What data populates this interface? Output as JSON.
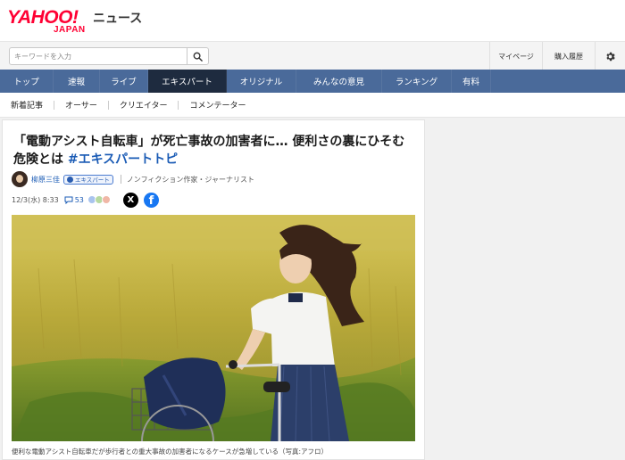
{
  "header": {
    "logo_main": "YAHOO!",
    "logo_sub": "JAPAN",
    "section": "ニュース"
  },
  "search": {
    "placeholder": "キーワードを入力",
    "icon": "search-icon"
  },
  "utilities": {
    "mypage": "マイページ",
    "history": "購入履歴",
    "settings_icon": "gear-icon"
  },
  "nav": {
    "items": [
      {
        "label": "トップ"
      },
      {
        "label": "速報"
      },
      {
        "label": "ライブ"
      },
      {
        "label": "エキスパート"
      },
      {
        "label": "オリジナル"
      },
      {
        "label": "みんなの意見"
      },
      {
        "label": "ランキング"
      },
      {
        "label": "有料"
      }
    ],
    "active": "エキスパート"
  },
  "subnav": {
    "items": [
      {
        "label": "新着記事"
      },
      {
        "label": "オーサー"
      },
      {
        "label": "クリエイター"
      },
      {
        "label": "コメンテーター"
      }
    ]
  },
  "article": {
    "title_text": "「電動アシスト自転車」が死亡事故の加害者に… 便利さの裏にひそむ危険とは ",
    "hashtag": "#エキスパートトピ",
    "author": {
      "name": "柳原三佳",
      "badge": "エキスパート",
      "role": "ノンフィクション作家・ジャーナリスト"
    },
    "date": "12/3(水) 8:33",
    "comment_count": "53",
    "share": {
      "x_label": "X",
      "facebook_label": "f"
    },
    "caption": "便利な電動アシスト自転車だが歩行者との重大事故の加害者になるケースが急増している（写真:アフロ）"
  },
  "colors": {
    "brand_red": "#ff0033",
    "nav_bg": "#4a6a9a",
    "nav_active": "#1e2b3f",
    "link_blue": "#1a5bb5"
  }
}
